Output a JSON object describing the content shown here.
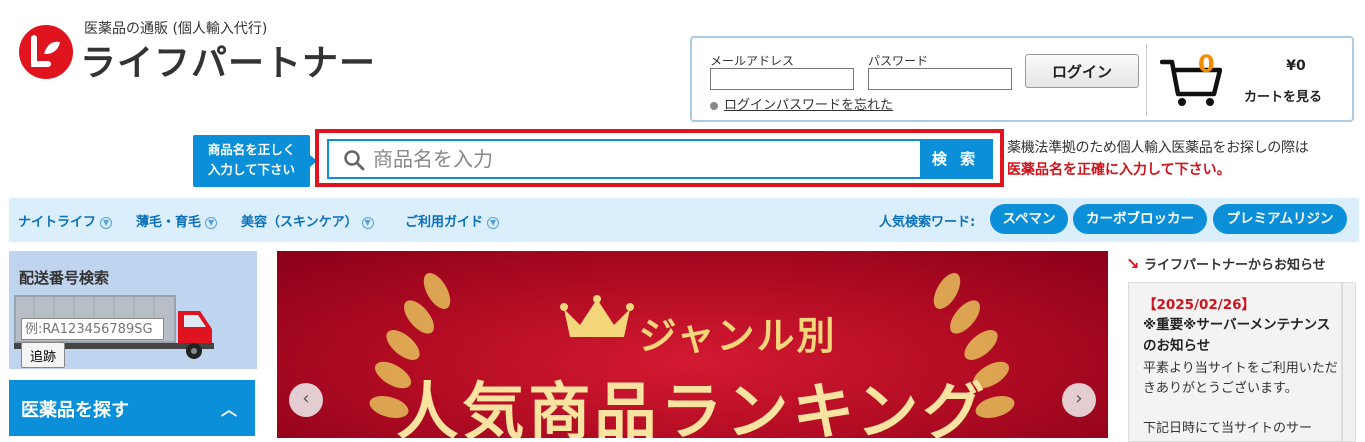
{
  "header": {
    "logo_sub": "医薬品の通販 (個人輸入代行)",
    "logo_name": "ライフパートナー"
  },
  "login": {
    "email_label": "メールアドレス",
    "password_label": "パスワード",
    "login_button": "ログイン",
    "forgot_link": "ログインパスワードを忘れた"
  },
  "cart": {
    "count": "0",
    "price": "¥0",
    "label": "カートを見る"
  },
  "search": {
    "hint_line1": "商品名を正しく",
    "hint_line2": "入力して下さい",
    "placeholder": "商品名を入力",
    "button": "検 索",
    "note_line1": "薬機法準拠のため個人輸入医薬品をお探しの際は",
    "note_line2": "医薬品名を正確に入力して下さい。"
  },
  "nav": {
    "items": [
      {
        "label": "ナイトライフ"
      },
      {
        "label": "薄毛・育毛"
      },
      {
        "label": "美容（スキンケア）"
      },
      {
        "label": "ご利用ガイド"
      }
    ],
    "popular_label": "人気検索ワード:",
    "keywords": [
      {
        "label": "スペマン"
      },
      {
        "label": "カーボブロッカー"
      },
      {
        "label": "プレミアムリジン"
      }
    ]
  },
  "tracking": {
    "title": "配送番号検索",
    "placeholder": "例:RA123456789SG",
    "button": "追跡"
  },
  "find_drugs": {
    "label": "医薬品を探す"
  },
  "banner": {
    "subtitle": "ジャンル別",
    "title": "人気商品ランキング"
  },
  "news": {
    "section_title": "ライフパートナーからお知らせ",
    "date": "【2025/02/26】",
    "headline": "※重要※サーバーメンテナンスのお知らせ",
    "body_line1": "平素より当サイトをご利用いただきありがとうございます。",
    "body_line2": "下記日時にて当サイトのサー"
  },
  "colors": {
    "brand_blue": "#0a8fd8",
    "alert_red": "#d0121b",
    "cart_orange": "#f28c00",
    "banner_red": "#b50d24"
  }
}
